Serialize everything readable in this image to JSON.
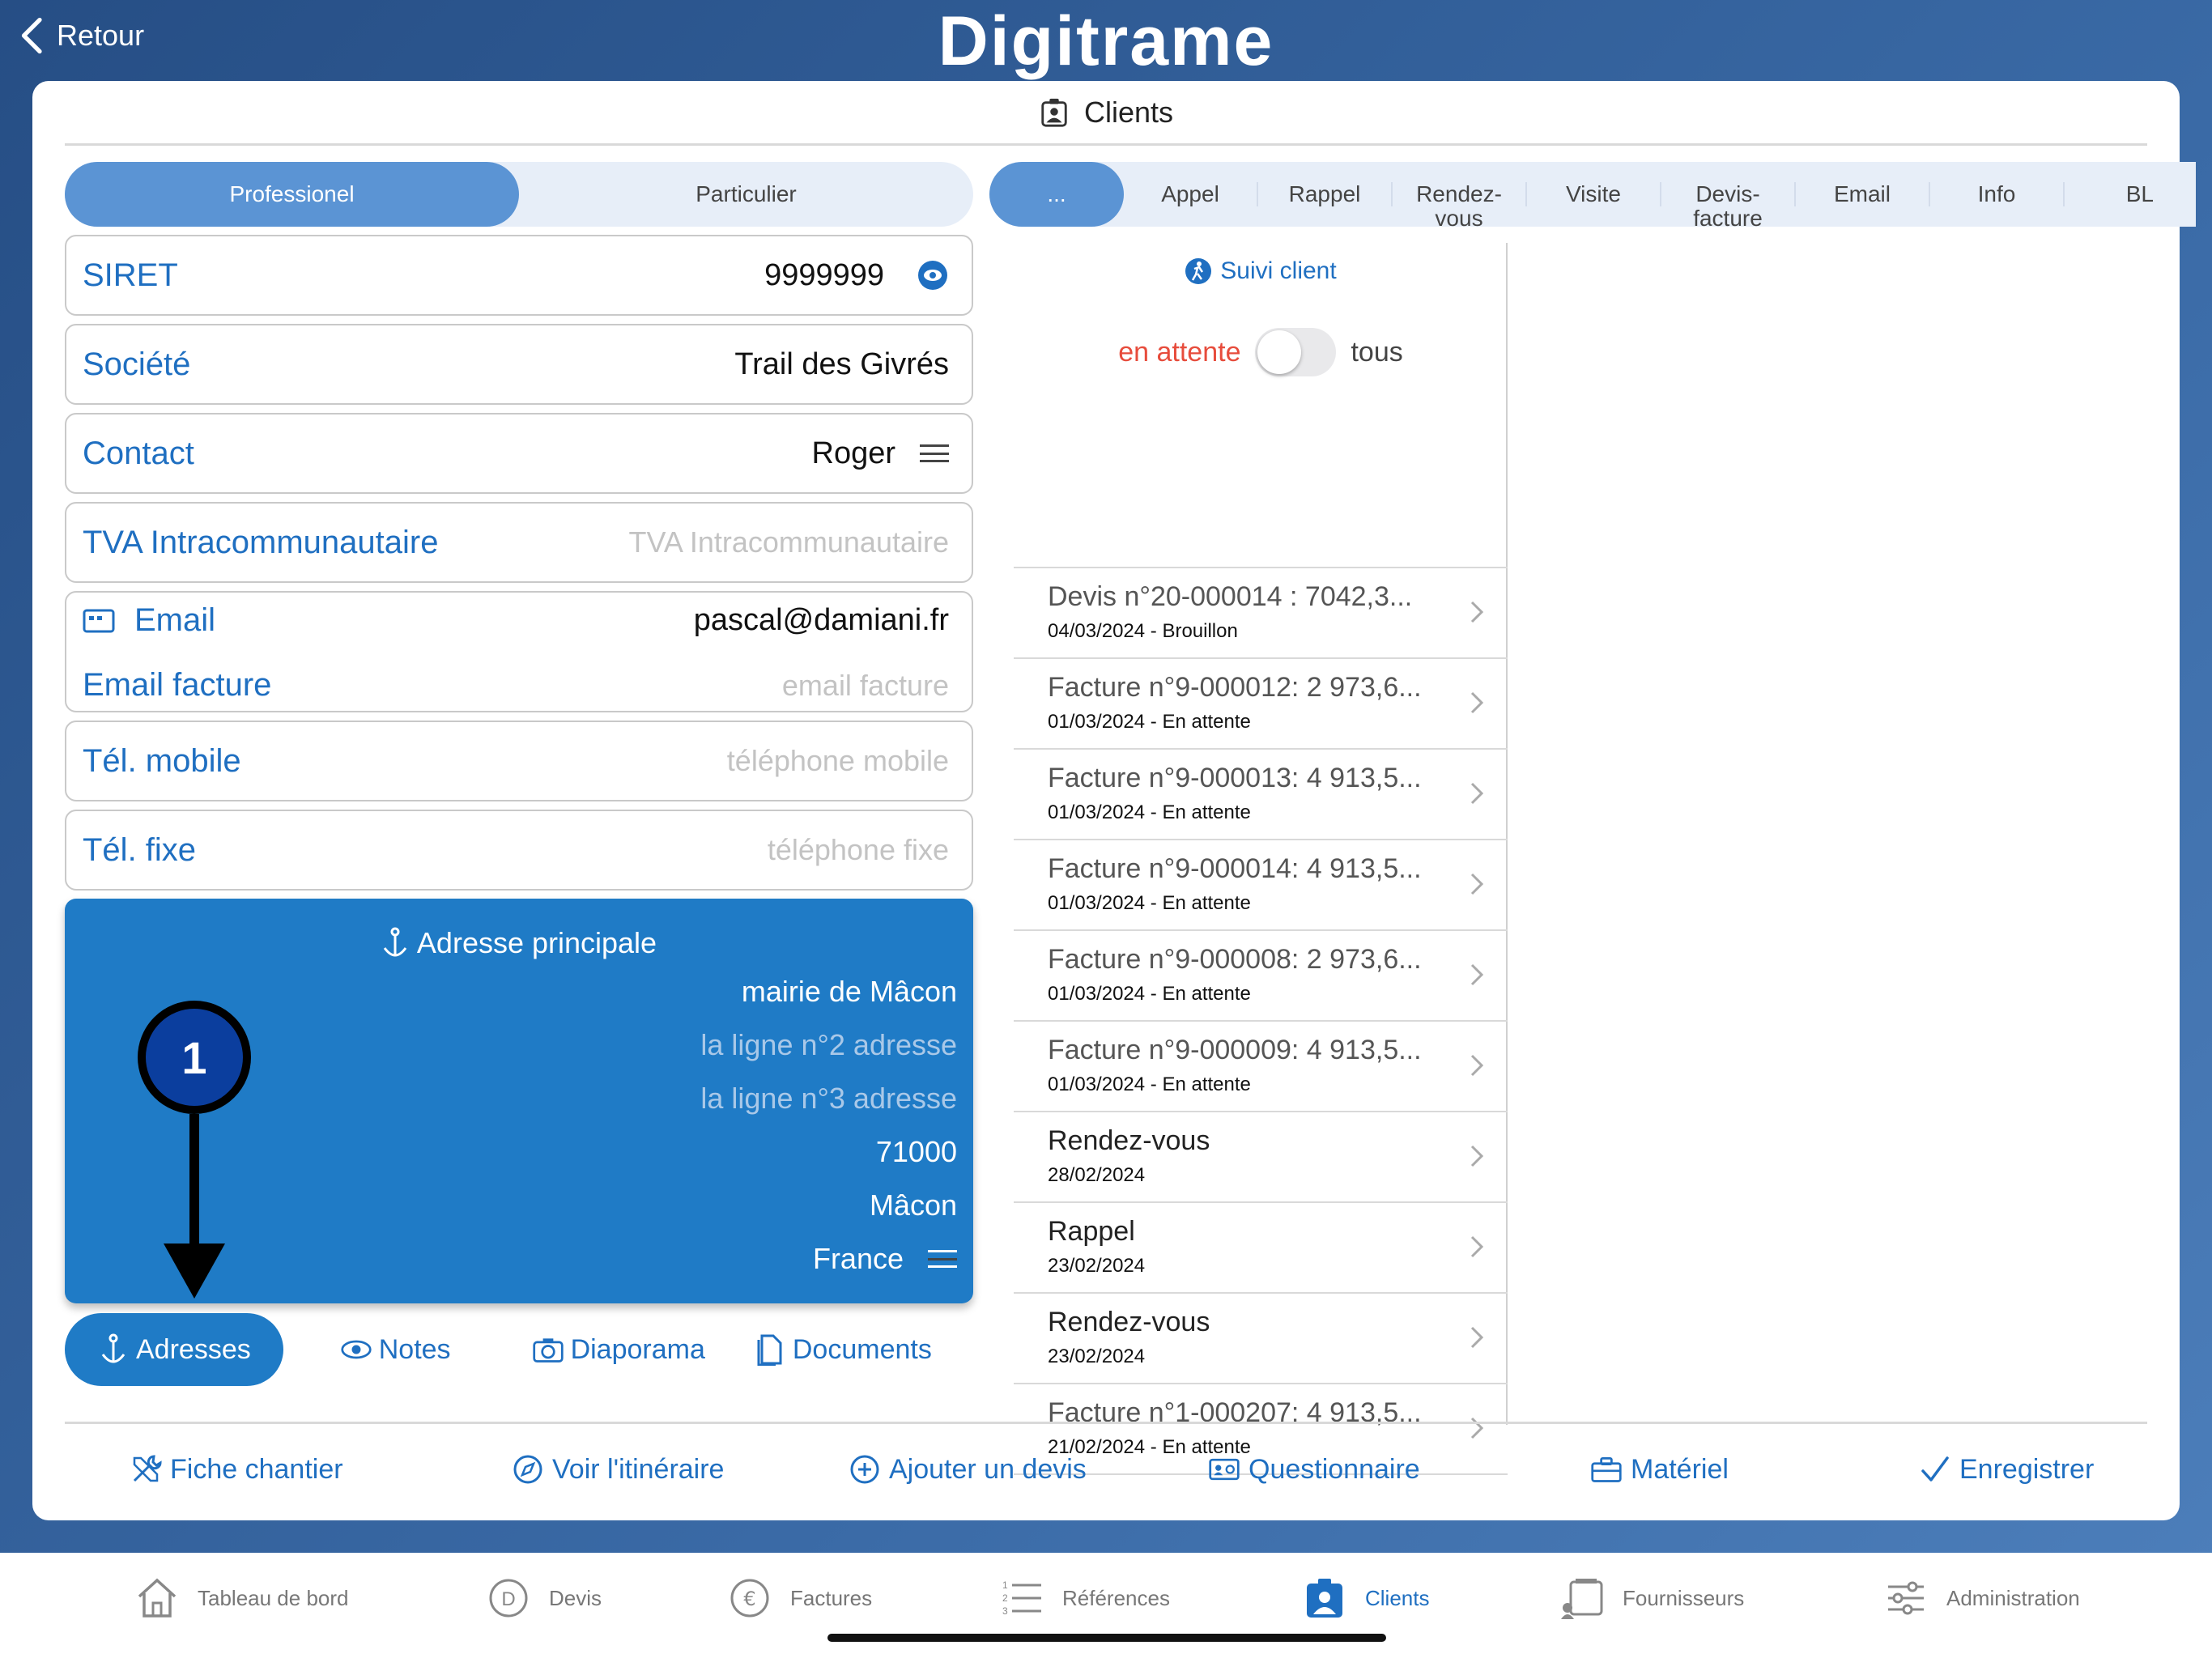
{
  "topbar": {
    "back_label": "Retour",
    "logo": "Digitrame"
  },
  "header": {
    "title": "Clients"
  },
  "segment": {
    "items": [
      "Professionel",
      "Particulier"
    ],
    "active": "Professionel"
  },
  "fields": {
    "siret": {
      "label": "SIRET",
      "value": "9999999"
    },
    "societe": {
      "label": "Société",
      "value": "Trail des Givrés"
    },
    "contact": {
      "label": "Contact",
      "value": "Roger"
    },
    "tva": {
      "label": "TVA Intracommunautaire",
      "placeholder": "TVA Intracommunautaire"
    },
    "email": {
      "label": "Email",
      "value": "pascal@damiani.fr"
    },
    "email_facture": {
      "label": "Email facture",
      "placeholder": "email facture"
    },
    "tel_mobile": {
      "label": "Tél. mobile",
      "placeholder": "téléphone mobile"
    },
    "tel_fixe": {
      "label": "Tél. fixe",
      "placeholder": "téléphone fixe"
    }
  },
  "address": {
    "title": "Adresse principale",
    "line1": "mairie de Mâcon",
    "line2": "la ligne n°2 adresse",
    "line3": "la ligne n°3 adresse",
    "zip": "71000",
    "city": "Mâcon",
    "country": "France"
  },
  "bottom_tabs": {
    "adresses": "Adresses",
    "notes": "Notes",
    "diaporama": "Diaporama",
    "documents": "Documents"
  },
  "filter_tabs": [
    "...",
    "Appel",
    "Rappel",
    "Rendez-vous",
    "Visite",
    "Devis-facture",
    "Email",
    "Info",
    "BL"
  ],
  "suivi": {
    "label": "Suivi client",
    "toggle_on_label": "en attente",
    "toggle_off_label": "tous"
  },
  "history": [
    {
      "title": "Devis n°20-000014 : 7042,3...",
      "sub": "04/03/2024 - Brouillon"
    },
    {
      "title": "Facture n°9-000012: 2 973,6...",
      "sub": "01/03/2024  - En attente"
    },
    {
      "title": "Facture n°9-000013: 4 913,5...",
      "sub": "01/03/2024  - En attente"
    },
    {
      "title": "Facture n°9-000014: 4 913,5...",
      "sub": "01/03/2024  - En attente"
    },
    {
      "title": "Facture n°9-000008: 2 973,6...",
      "sub": "01/03/2024  - En attente"
    },
    {
      "title": "Facture n°9-000009: 4 913,5...",
      "sub": "01/03/2024  - En attente"
    },
    {
      "title": "Rendez-vous",
      "sub": "28/02/2024"
    },
    {
      "title": "Rappel",
      "sub": "23/02/2024"
    },
    {
      "title": "Rendez-vous",
      "sub": "23/02/2024"
    },
    {
      "title": "Facture n°1-000207: 4 913,5...",
      "sub": "21/02/2024  - En attente"
    }
  ],
  "actions": {
    "fiche_chantier": "Fiche chantier",
    "itineraire": "Voir l'itinéraire",
    "ajouter_devis": "Ajouter un devis",
    "questionnaire": "Questionnaire",
    "materiel": "Matériel",
    "enregistrer": "Enregistrer"
  },
  "tabbar": {
    "tableau": "Tableau de bord",
    "devis": "Devis",
    "factures": "Factures",
    "references": "Références",
    "clients": "Clients",
    "fournisseurs": "Fournisseurs",
    "administration": "Administration"
  },
  "annotation": {
    "number": "1"
  },
  "colors": {
    "accent": "#1f6fc1",
    "address_bg": "#1f7bc6",
    "status_pending": "#e74c3c",
    "annotation": "#0b3e9e"
  }
}
